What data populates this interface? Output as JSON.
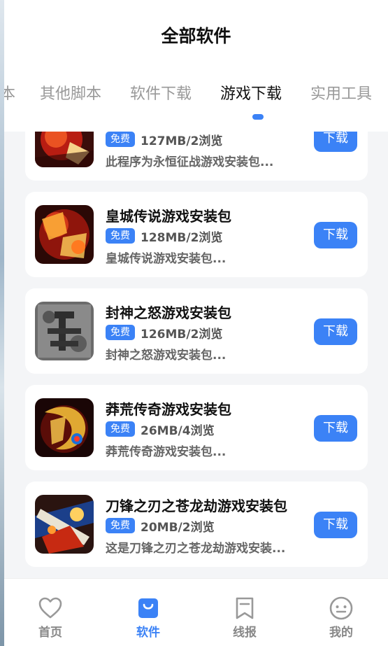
{
  "page": {
    "title": "全部软件"
  },
  "tabs": [
    {
      "label": "本"
    },
    {
      "label": "其他脚本"
    },
    {
      "label": "软件下载"
    },
    {
      "label": "游戏下载",
      "active": true
    },
    {
      "label": "实用工具"
    }
  ],
  "items": [
    {
      "name": "",
      "badge": "免费",
      "stats": "127MB/2浏览",
      "desc": "此程序为永恒征战游戏安装包...",
      "button": "下载",
      "icon": "game-thumb-yonghengzhengzhan"
    },
    {
      "name": "皇城传说游戏安装包",
      "badge": "免费",
      "stats": "128MB/2浏览",
      "desc": "皇城传说游戏安装包...",
      "button": "下载",
      "icon": "game-thumb-huangchengchuanshuo"
    },
    {
      "name": "封神之怒游戏安装包",
      "badge": "免费",
      "stats": "126MB/2浏览",
      "desc": "封神之怒游戏安装包...",
      "button": "下载",
      "icon": "game-thumb-fengshenzhinu"
    },
    {
      "name": "莽荒传奇游戏安装包",
      "badge": "免费",
      "stats": "26MB/4浏览",
      "desc": "莽荒传奇游戏安装包...",
      "button": "下载",
      "icon": "game-thumb-manghuangchuanqi"
    },
    {
      "name": "刀锋之刃之苍龙劫游戏安装包",
      "badge": "免费",
      "stats": "20MB/2浏览",
      "desc": "这是刀锋之刃之苍龙劫游戏安装...",
      "button": "下载",
      "icon": "game-thumb-daofengzhiren"
    }
  ],
  "nav": [
    {
      "label": "首页",
      "icon": "heart-icon"
    },
    {
      "label": "软件",
      "icon": "bag-icon",
      "active": true
    },
    {
      "label": "线报",
      "icon": "bookmark-icon"
    },
    {
      "label": "我的",
      "icon": "smile-icon"
    }
  ],
  "colors": {
    "accent": "#3b82f6",
    "text": "#111111",
    "muted": "#888888",
    "background": "#f4f5f7"
  }
}
